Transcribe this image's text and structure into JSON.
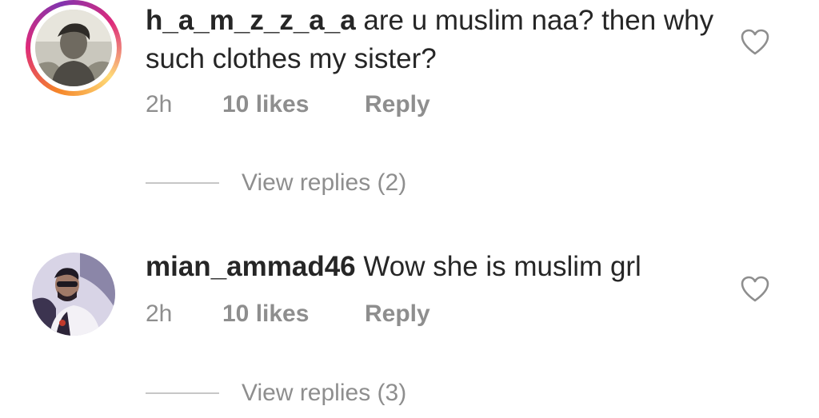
{
  "comments": [
    {
      "username": "h_a_m_z_z_a_a",
      "text": " are u muslim naa? then why such clothes my sister?",
      "time": "2h",
      "likes": "10 likes",
      "reply_label": "Reply",
      "view_replies": "View replies (2)",
      "has_story_ring": true
    },
    {
      "username": "mian_ammad46",
      "text": " Wow she is muslim grl",
      "time": "2h",
      "likes": "10 likes",
      "reply_label": "Reply",
      "view_replies": "View replies (3)",
      "has_story_ring": false
    }
  ],
  "icons": {
    "like": "heart-outline-icon"
  },
  "colors": {
    "text": "#262626",
    "secondary": "#8e8e8e",
    "divider": "#c7c7c7"
  }
}
